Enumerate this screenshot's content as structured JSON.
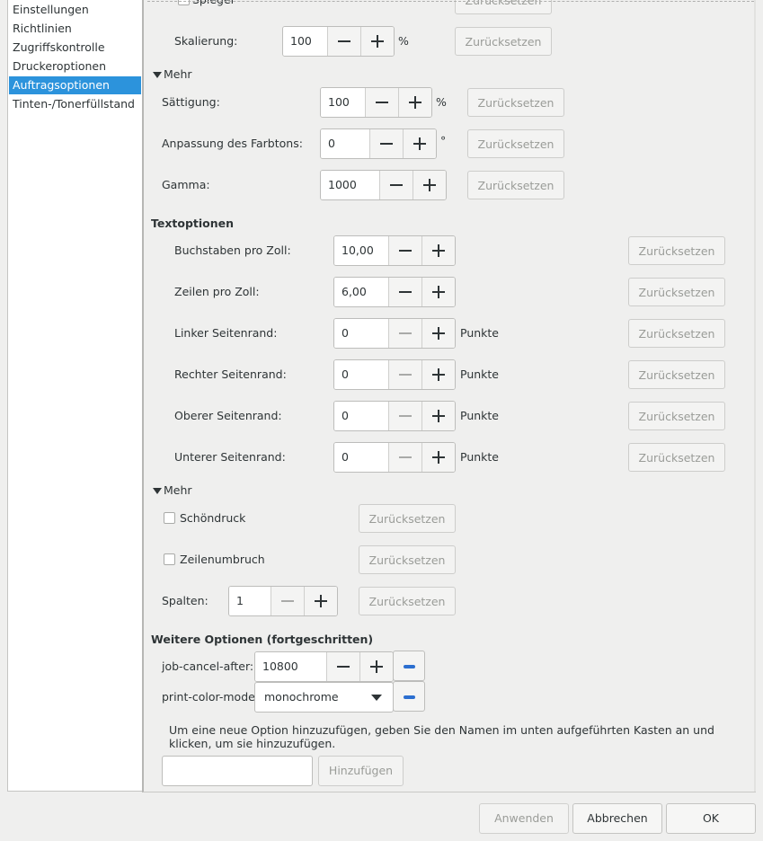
{
  "sidebar": {
    "items": [
      {
        "label": "Einstellungen"
      },
      {
        "label": "Richtlinien"
      },
      {
        "label": "Zugriffskontrolle"
      },
      {
        "label": "Druckeroptionen"
      },
      {
        "label": "Auftragsoptionen"
      },
      {
        "label": "Tinten-/Tonerfüllstand"
      }
    ],
    "selected": "Auftragsoptionen"
  },
  "top": {
    "partial_label": "Spiegel",
    "partial_reset": "Zurücksetzen",
    "scaling": {
      "label": "Skalierung:",
      "value": "100",
      "unit": "%",
      "reset": "Zurücksetzen"
    }
  },
  "image_more": {
    "toggle": "Mehr",
    "saturation": {
      "label": "Sättigung:",
      "value": "100",
      "unit": "%",
      "reset": "Zurücksetzen"
    },
    "hue": {
      "label": "Anpassung des Farbtons:",
      "value": "0",
      "unit": "°",
      "reset": "Zurücksetzen"
    },
    "gamma": {
      "label": "Gamma:",
      "value": "1000",
      "reset": "Zurücksetzen"
    }
  },
  "text_options": {
    "heading": "Textoptionen",
    "cpi": {
      "label": "Buchstaben pro Zoll:",
      "value": "10,00",
      "reset": "Zurücksetzen"
    },
    "lpi": {
      "label": "Zeilen pro Zoll:",
      "value": "6,00",
      "reset": "Zurücksetzen"
    },
    "left": {
      "label": "Linker Seitenrand:",
      "value": "0",
      "unit": "Punkte",
      "reset": "Zurücksetzen"
    },
    "right": {
      "label": "Rechter Seitenrand:",
      "value": "0",
      "unit": "Punkte",
      "reset": "Zurücksetzen"
    },
    "top": {
      "label": "Oberer Seitenrand:",
      "value": "0",
      "unit": "Punkte",
      "reset": "Zurücksetzen"
    },
    "bottom": {
      "label": "Unterer Seitenrand:",
      "value": "0",
      "unit": "Punkte",
      "reset": "Zurücksetzen"
    }
  },
  "text_more": {
    "toggle": "Mehr",
    "prettyprint": {
      "label": "Schöndruck",
      "checked": false,
      "reset": "Zurücksetzen"
    },
    "wrap": {
      "label": "Zeilenumbruch",
      "checked": false,
      "reset": "Zurücksetzen"
    },
    "columns": {
      "label": "Spalten:",
      "value": "1",
      "reset": "Zurücksetzen"
    }
  },
  "advanced": {
    "heading": "Weitere Optionen (fortgeschritten)",
    "job_cancel_after": {
      "label": "job-cancel-after:",
      "value": "10800"
    },
    "print_color_mode": {
      "label": "print-color-mode:",
      "value": "monochrome"
    },
    "hint": "Um eine neue Option hinzuzufügen, geben Sie den Namen im unten aufgeführten Kasten an und klicken, um sie hinzuzufügen.",
    "new_option_value": "",
    "add_button": "Hinzufügen"
  },
  "dialog": {
    "apply": "Anwenden",
    "cancel": "Abbrechen",
    "ok": "OK"
  },
  "colors": {
    "selection": "#2c93dc",
    "remove_icon": "#2c6fd0"
  }
}
